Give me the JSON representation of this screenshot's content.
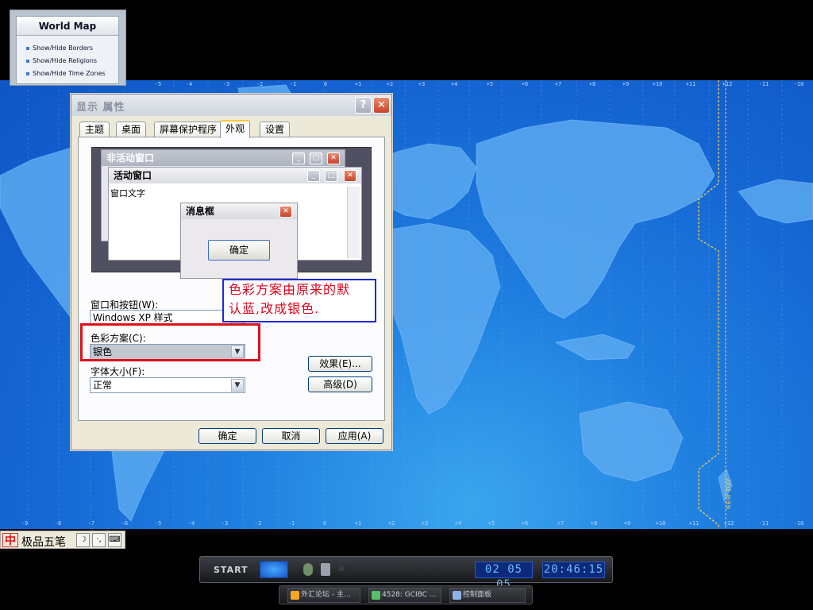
{
  "world_map_panel": {
    "title": "World Map",
    "items": [
      "Show/Hide Borders",
      "Show/Hide Religions",
      "Show/Hide Time Zones"
    ]
  },
  "time_zone_labels": [
    "-5",
    "-4",
    "-3",
    "-2",
    "-1",
    "0",
    "+1",
    "+2",
    "+3",
    "+4",
    "+5",
    "+6",
    "+7",
    "+8",
    "+9",
    "+10",
    "+11",
    "+12",
    "-11",
    "-10"
  ],
  "time_zone_labels_bottom": [
    "-9",
    "-8",
    "-7",
    "-6",
    "-5",
    "-4",
    "-3",
    "-2",
    "-1",
    "0",
    "+1",
    "+2",
    "+3",
    "+4",
    "+5",
    "+6",
    "+7",
    "+8",
    "+9",
    "+10",
    "+11",
    "+12",
    "-11",
    "-10"
  ],
  "date_line_label": "NEW DAY",
  "dialog": {
    "title": "显示 属性",
    "help_button": "?",
    "close_button": "✕",
    "tabs": [
      "主题",
      "桌面",
      "屏幕保护程序",
      "外观",
      "设置"
    ],
    "active_tab": "外观",
    "preview": {
      "inactive_window_title": "非活动窗口",
      "active_window_title": "活动窗口",
      "window_text": "窗口文字",
      "message_box_title": "消息框",
      "message_box_ok": "确定"
    },
    "windows_and_buttons": {
      "label": "窗口和按钮(W):",
      "value": "Windows XP 样式"
    },
    "color_scheme": {
      "label": "色彩方案(C):",
      "value": "银色"
    },
    "font_size": {
      "label": "字体大小(F):",
      "value": "正常"
    },
    "effects_button": "效果(E)...",
    "advanced_button": "高级(D)",
    "ok_button": "确定",
    "cancel_button": "取消",
    "apply_button": "应用(A)"
  },
  "annotation": {
    "line1": "色彩方案由原来的默",
    "line2": "认蓝,改成银色."
  },
  "ime_bar": {
    "logo": "中",
    "name": "极品五笔",
    "moon": "☽",
    "punct": "·,",
    "keyboard": "⌨"
  },
  "dock": {
    "start_label": "START",
    "date": "02 05 05",
    "time": "20:46:15"
  },
  "taskbar": {
    "tasks": [
      "外汇论坛 - 主...",
      "4528: GCIBC ...",
      "控制面板"
    ]
  },
  "colors": {
    "map_ocean": "#1464d2",
    "annotation_text": "#e0001a",
    "annotation_blue_border": "#1c2bd8",
    "annotation_red_border": "#e0101a",
    "active_tab_accent": "#ffc83c"
  }
}
